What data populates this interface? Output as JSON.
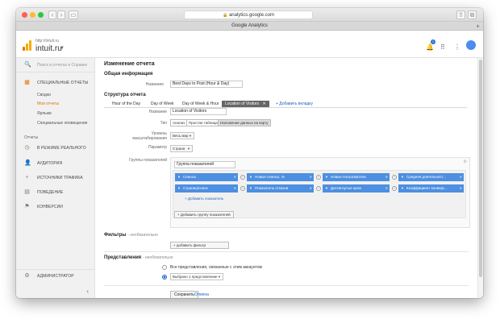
{
  "browser": {
    "url": "analytics.google.com",
    "tab_title": "Google Analytics"
  },
  "header": {
    "account_url": "http://intuit.ru",
    "account_name": "intuit.ru",
    "notification_count": "1"
  },
  "sidebar": {
    "search_placeholder": "Поиск в отчетах и Справке",
    "custom_reports": "Специальные отчеты",
    "sub_items": [
      "Сводки",
      "Мои отчеты",
      "Ярлыки",
      "Специальные оповещения"
    ],
    "reports_section": "Отчеты",
    "items": [
      "В режиме реального",
      "Аудитория",
      "Источники трафика",
      "Поведение",
      "Конверсии"
    ],
    "admin": "Администратор"
  },
  "main": {
    "title": "Изменение отчета",
    "general_info": "Общая информация",
    "name_label": "Название",
    "name_value": "Best Days to Post (Hour & Day)",
    "structure": "Структура отчета",
    "tabs": [
      "Hour of the Day",
      "Day of Week",
      "Day of Week & Hour",
      "Location of Visitors"
    ],
    "add_tab": "+ Добавить вкладку",
    "tab_name_label": "Название",
    "tab_name_value": "Location of Visitors",
    "type_label": "Тип",
    "type_options": [
      "Анализ",
      "Простая таблица",
      "Наложение данных на карту"
    ],
    "zoom_label": "Уровень масштабирования",
    "zoom_value": "Весь мир",
    "param_label": "Параметр",
    "param_value": "Страна",
    "metric_groups_label": "Группы показателей",
    "group_name": "Группа показателей",
    "metrics_row1": [
      "Сеансы",
      "Новые сеансы, %",
      "Новые пользователи",
      "Средняя длительност..."
    ],
    "metrics_row2": [
      "Страниц/сеанс",
      "Показатель отказов",
      "Достигнутые цели",
      "Коэффициент конверс..."
    ],
    "add_metric": "+ Добавить показатель",
    "add_group": "+ Добавить группу показателей",
    "filters": "Фильтры",
    "optional": "- необязательно",
    "add_filter": "+ добавить фильтр",
    "views": "Представления",
    "views_all": "Все представления, связанные с этим аккаунтом",
    "views_selected": "Выбрано 1 представление",
    "save": "Сохранить",
    "cancel": "Отмена"
  },
  "colors": {
    "accent_orange": "#e37400",
    "chip_blue": "#4d8fe0",
    "link_blue": "#1a63c8"
  }
}
